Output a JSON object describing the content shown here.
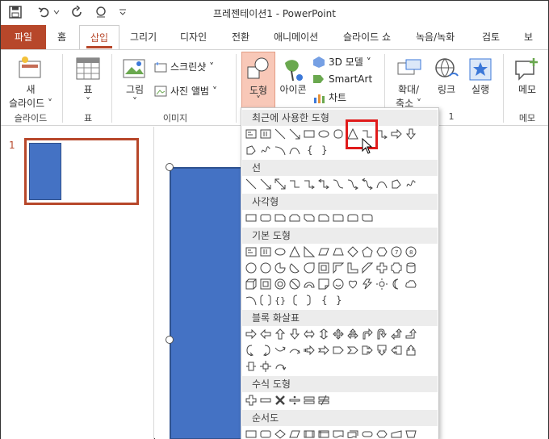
{
  "window": {
    "title": "프레젠테이션1  -  PowerPoint"
  },
  "tabs": [
    "파일",
    "홈",
    "삽입",
    "그리기",
    "디자인",
    "전환",
    "애니메이션",
    "슬라이드 쇼",
    "녹음/녹화",
    "검토",
    "보기"
  ],
  "ribbon": {
    "new_slide": [
      "새",
      "슬라이드"
    ],
    "table": "표",
    "picture": "그림",
    "screenshot": "스크린샷",
    "photo_album": "사진 앨범",
    "shapes": "도형",
    "icons": "아이콘",
    "model3d": "3D 모델",
    "smartart": "SmartArt",
    "chart": "차트",
    "zoom": [
      "확대/",
      "축소"
    ],
    "link": "링크",
    "action": "실행",
    "comment": "메모",
    "groups": {
      "slides": "슬라이드",
      "tables": "표",
      "images": "이미지",
      "comments": "메모",
      "links_tail": "1"
    }
  },
  "slides": {
    "number": "1"
  },
  "dropdown": {
    "categories": [
      "최근에 사용한 도형",
      "선",
      "사각형",
      "기본 도형",
      "블록 화살표",
      "수식 도형",
      "순서도"
    ]
  },
  "colors": {
    "accent": "#b7472a",
    "shape_fill": "#4472c4",
    "highlight": "#e01b1b"
  }
}
